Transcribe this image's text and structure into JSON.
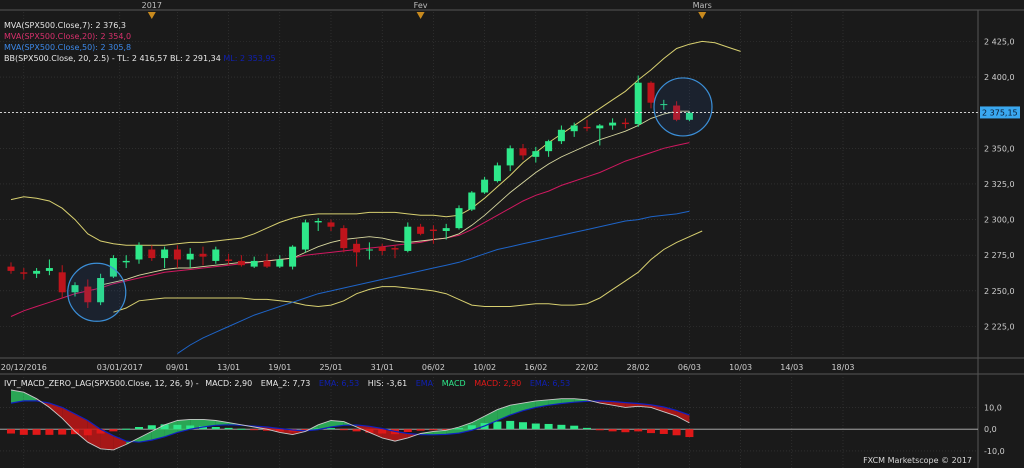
{
  "colors": {
    "background": "#1a1a1a",
    "grid": "#3a3a3a",
    "up_candle": "#2ee88a",
    "down_candle": "#c0141c",
    "mva7": "#d8d8a0",
    "mva20": "#d01860",
    "mva50": "#1e64c8",
    "bollinger": "#d8d070",
    "last_price_badge": "#3aa8f0",
    "highlight_circle": "#3b8fd8",
    "macd_hist_up": "#2ee88a",
    "macd_hist_down": "#e01818",
    "macd_cloud_up": "#2ec060",
    "macd_cloud_down": "#c01818",
    "macd_line": "#c8c8c8",
    "ema_line": "#1020c0"
  },
  "legend": {
    "mva7": "MVA(SPX500.Close,7): 2 376,3",
    "mva20": "MVA(SPX500.Close,20): 2 354,0",
    "mva50": "MVA(SPX500.Close,50): 2 305,8",
    "bb_main": "BB(SPX500.Close, 20, 2.5) -  TL: 2 416,57  BL: 2 291,34",
    "bb_ml": "ML: 2 353,95"
  },
  "macd_header": {
    "name": "IVT_MACD_ZERO_LAG(SPX500.Close, 12, 26, 9) -",
    "macd": "MACD: 2,90",
    "ema2": "EMA_2: 7,73",
    "ema_val": "EMA: 6,53",
    "his": "HIS: -3,61",
    "ema_lbl": "EMA",
    "macd_lbl": "MACD",
    "macd2": "MACD: 2,90",
    "ema2b": "EMA: 6,53"
  },
  "copyright": "FXCM Marketscope © 2017",
  "chart_data": [
    {
      "type": "candlestick",
      "instrument": "SPX500",
      "last_price": 2375.15,
      "last_price_label": "2 375,15",
      "y_range": [
        2205,
        2440
      ],
      "y_ticks": [
        2225,
        2250,
        2275,
        2300,
        2325,
        2350,
        2375,
        2400,
        2425
      ],
      "y_tick_labels": [
        "2 225,0",
        "2 250,0",
        "2 275,0",
        "2 300,0",
        "2 325,0",
        "2 350,0",
        "2 375,0",
        "2 400,0",
        "2 425,0"
      ],
      "top_markers": [
        {
          "label": "2017",
          "index": 11
        },
        {
          "label": "Fev",
          "index": 32
        },
        {
          "label": "Mars",
          "index": 54
        }
      ],
      "x_ticks": [
        {
          "label": "20/12/2016",
          "index": 1
        },
        {
          "label": "03/01/2017",
          "index": 8.5
        },
        {
          "label": "09/01",
          "index": 13
        },
        {
          "label": "13/01",
          "index": 17
        },
        {
          "label": "19/01",
          "index": 21
        },
        {
          "label": "25/01",
          "index": 25
        },
        {
          "label": "31/01",
          "index": 29
        },
        {
          "label": "06/02",
          "index": 33
        },
        {
          "label": "10/02",
          "index": 37
        },
        {
          "label": "16/02",
          "index": 41
        },
        {
          "label": "22/02",
          "index": 45
        },
        {
          "label": "28/02",
          "index": 49
        },
        {
          "label": "06/03",
          "index": 53
        },
        {
          "label": "10/03",
          "index": 57
        },
        {
          "label": "14/03",
          "index": 61
        },
        {
          "label": "18/03",
          "index": 65
        }
      ],
      "candles": [
        {
          "o": 2267,
          "h": 2270,
          "l": 2262,
          "c": 2264
        },
        {
          "o": 2263,
          "h": 2266,
          "l": 2258,
          "c": 2262
        },
        {
          "o": 2262,
          "h": 2266,
          "l": 2259,
          "c": 2264
        },
        {
          "o": 2264,
          "h": 2272,
          "l": 2261,
          "c": 2266
        },
        {
          "o": 2263,
          "h": 2268,
          "l": 2245,
          "c": 2249
        },
        {
          "o": 2249,
          "h": 2256,
          "l": 2246,
          "c": 2254
        },
        {
          "o": 2253,
          "h": 2258,
          "l": 2238,
          "c": 2242
        },
        {
          "o": 2242,
          "h": 2262,
          "l": 2240,
          "c": 2259
        },
        {
          "o": 2260,
          "h": 2275,
          "l": 2259,
          "c": 2273
        },
        {
          "o": 2270,
          "h": 2275,
          "l": 2266,
          "c": 2271
        },
        {
          "o": 2272,
          "h": 2284,
          "l": 2269,
          "c": 2282
        },
        {
          "o": 2279,
          "h": 2282,
          "l": 2271,
          "c": 2273
        },
        {
          "o": 2273,
          "h": 2281,
          "l": 2266,
          "c": 2279
        },
        {
          "o": 2279,
          "h": 2282,
          "l": 2266,
          "c": 2272
        },
        {
          "o": 2272,
          "h": 2280,
          "l": 2266,
          "c": 2276
        },
        {
          "o": 2276,
          "h": 2281,
          "l": 2268,
          "c": 2274
        },
        {
          "o": 2271,
          "h": 2281,
          "l": 2269,
          "c": 2279
        },
        {
          "o": 2272,
          "h": 2276,
          "l": 2268,
          "c": 2271
        },
        {
          "o": 2271,
          "h": 2275,
          "l": 2267,
          "c": 2268
        },
        {
          "o": 2267,
          "h": 2274,
          "l": 2266,
          "c": 2271
        },
        {
          "o": 2271,
          "h": 2276,
          "l": 2266,
          "c": 2267
        },
        {
          "o": 2267,
          "h": 2275,
          "l": 2266,
          "c": 2272
        },
        {
          "o": 2267,
          "h": 2282,
          "l": 2265,
          "c": 2281
        },
        {
          "o": 2279,
          "h": 2300,
          "l": 2277,
          "c": 2298
        },
        {
          "o": 2298,
          "h": 2301,
          "l": 2292,
          "c": 2299
        },
        {
          "o": 2298,
          "h": 2300,
          "l": 2292,
          "c": 2295
        },
        {
          "o": 2294,
          "h": 2296,
          "l": 2277,
          "c": 2280
        },
        {
          "o": 2283,
          "h": 2286,
          "l": 2267,
          "c": 2277
        },
        {
          "o": 2279,
          "h": 2284,
          "l": 2272,
          "c": 2279
        },
        {
          "o": 2281,
          "h": 2283,
          "l": 2275,
          "c": 2278
        },
        {
          "o": 2280,
          "h": 2282,
          "l": 2273,
          "c": 2279
        },
        {
          "o": 2278,
          "h": 2298,
          "l": 2277,
          "c": 2295
        },
        {
          "o": 2295,
          "h": 2297,
          "l": 2289,
          "c": 2290
        },
        {
          "o": 2293,
          "h": 2296,
          "l": 2283,
          "c": 2292
        },
        {
          "o": 2292,
          "h": 2297,
          "l": 2286,
          "c": 2294
        },
        {
          "o": 2294,
          "h": 2310,
          "l": 2293,
          "c": 2308
        },
        {
          "o": 2307,
          "h": 2320,
          "l": 2306,
          "c": 2319
        },
        {
          "o": 2319,
          "h": 2330,
          "l": 2318,
          "c": 2328
        },
        {
          "o": 2327,
          "h": 2340,
          "l": 2326,
          "c": 2338
        },
        {
          "o": 2338,
          "h": 2352,
          "l": 2334,
          "c": 2350
        },
        {
          "o": 2350,
          "h": 2353,
          "l": 2342,
          "c": 2345
        },
        {
          "o": 2344,
          "h": 2351,
          "l": 2340,
          "c": 2348
        },
        {
          "o": 2348,
          "h": 2356,
          "l": 2344,
          "c": 2355
        },
        {
          "o": 2355,
          "h": 2366,
          "l": 2353,
          "c": 2363
        },
        {
          "o": 2362,
          "h": 2368,
          "l": 2358,
          "c": 2366
        },
        {
          "o": 2365,
          "h": 2370,
          "l": 2362,
          "c": 2364
        },
        {
          "o": 2364,
          "h": 2367,
          "l": 2352,
          "c": 2366
        },
        {
          "o": 2366,
          "h": 2371,
          "l": 2363,
          "c": 2368
        },
        {
          "o": 2368,
          "h": 2371,
          "l": 2364,
          "c": 2367
        },
        {
          "o": 2367,
          "h": 2401,
          "l": 2365,
          "c": 2396
        },
        {
          "o": 2396,
          "h": 2397,
          "l": 2378,
          "c": 2382
        },
        {
          "o": 2381,
          "h": 2384,
          "l": 2377,
          "c": 2381
        },
        {
          "o": 2380,
          "h": 2383,
          "l": 2369,
          "c": 2370
        },
        {
          "o": 2370,
          "h": 2376,
          "l": 2369,
          "c": 2375
        }
      ],
      "bollinger_upper": [
        2314,
        2316,
        2315,
        2313,
        2308,
        2300,
        2290,
        2285,
        2283,
        2282,
        2282,
        2282,
        2282,
        2283,
        2284,
        2284,
        2285,
        2286,
        2287,
        2290,
        2294,
        2298,
        2301,
        2303,
        2304,
        2304,
        2304,
        2304,
        2305,
        2305,
        2305,
        2304,
        2303,
        2303,
        2302,
        2303,
        2308,
        2315,
        2323,
        2331,
        2340,
        2347,
        2354,
        2360,
        2366,
        2372,
        2378,
        2384,
        2390,
        2398,
        2405,
        2413,
        2420,
        2423,
        2425,
        2424,
        2421,
        2418
      ],
      "bollinger_lower": [
        null,
        null,
        null,
        null,
        null,
        null,
        null,
        null,
        2235,
        2238,
        2243,
        2244,
        2245,
        2245,
        2245,
        2245,
        2245,
        2245,
        2245,
        2244,
        2244,
        2243,
        2242,
        2240,
        2239,
        2240,
        2243,
        2248,
        2251,
        2253,
        2253,
        2252,
        2251,
        2250,
        2248,
        2244,
        2240,
        2239,
        2239,
        2239,
        2240,
        2241,
        2241,
        2240,
        2240,
        2241,
        2245,
        2251,
        2257,
        2263,
        2272,
        2279,
        2284,
        2288,
        2292
      ],
      "mva7": [
        null,
        null,
        null,
        null,
        null,
        null,
        null,
        2254,
        2256,
        2258,
        2261,
        2263,
        2265,
        2266,
        2266,
        2267,
        2268,
        2269,
        2270,
        2270,
        2271,
        2272,
        2273,
        2277,
        2281,
        2284,
        2286,
        2287,
        2288,
        2287,
        2285,
        2284,
        2285,
        2286,
        2287,
        2290,
        2296,
        2303,
        2311,
        2319,
        2326,
        2333,
        2339,
        2344,
        2348,
        2352,
        2356,
        2359,
        2362,
        2366,
        2371,
        2374,
        2376,
        2376
      ],
      "mva20": [
        2232,
        2236,
        2239,
        2242,
        2245,
        2248,
        2250,
        2252,
        2255,
        2257,
        2259,
        2261,
        2263,
        2264,
        2265,
        2266,
        2267,
        2268,
        2269,
        2270,
        2271,
        2272,
        2273,
        2275,
        2276,
        2277,
        2278,
        2279,
        2280,
        2281,
        2282,
        2283,
        2284,
        2286,
        2287,
        2289,
        2293,
        2298,
        2303,
        2308,
        2313,
        2317,
        2320,
        2324,
        2327,
        2330,
        2333,
        2337,
        2341,
        2344,
        2347,
        2350,
        2352,
        2354
      ],
      "mva50": [
        null,
        null,
        null,
        null,
        null,
        null,
        null,
        null,
        null,
        null,
        null,
        null,
        null,
        2206,
        2212,
        2217,
        2221,
        2225,
        2229,
        2233,
        2236,
        2239,
        2242,
        2245,
        2248,
        2250,
        2252,
        2254,
        2256,
        2258,
        2260,
        2262,
        2264,
        2266,
        2268,
        2270,
        2273,
        2276,
        2279,
        2281,
        2283,
        2285,
        2287,
        2289,
        2291,
        2293,
        2295,
        2297,
        2299,
        2300,
        2302,
        2303,
        2304,
        2305.8
      ],
      "highlight_circles": [
        {
          "index": 6.7,
          "value": 2249
        },
        {
          "index": 52.5,
          "value": 2379
        }
      ]
    },
    {
      "type": "bar",
      "name": "IVT_MACD_ZERO_LAG",
      "y_range": [
        -16,
        18
      ],
      "y_ticks": [
        10,
        0,
        -10
      ],
      "y_tick_labels": [
        "10,0",
        "0,0",
        "-10,0"
      ],
      "histogram": [
        -2.0,
        -2.6,
        -2.6,
        -2.6,
        -2.5,
        -2.3,
        -2.8,
        -2.0,
        -1.0,
        0.2,
        1.0,
        1.8,
        2.2,
        2.0,
        1.7,
        1.4,
        1.0,
        0.6,
        0.2,
        -0.3,
        -0.7,
        -1.0,
        -1.1,
        -0.5,
        0.3,
        0.5,
        -0.2,
        -1.0,
        -1.6,
        -2.0,
        -2.3,
        -1.3,
        -0.7,
        -0.5,
        -0.3,
        0.5,
        1.8,
        2.8,
        3.5,
        3.8,
        3.2,
        2.6,
        2.4,
        2.0,
        1.6,
        0.6,
        -0.5,
        -1.0,
        -1.4,
        -1.0,
        -1.8,
        -2.2,
        -2.8,
        -3.61
      ],
      "macd_line": [
        18,
        17,
        14,
        10,
        5,
        -1,
        -6,
        -9,
        -9.5,
        -7,
        -4,
        -1,
        2,
        4,
        4.5,
        4.5,
        4,
        3,
        2,
        1,
        0,
        -1.5,
        -2.5,
        -1,
        2,
        4,
        3.5,
        1,
        -1.5,
        -4,
        -5.5,
        -4,
        -2,
        -1,
        -0.5,
        1,
        3,
        6,
        9,
        11,
        12,
        13,
        13.5,
        14,
        14,
        13.5,
        12,
        11,
        10,
        10.5,
        10,
        8,
        6,
        2.9
      ],
      "ema_line": [
        12,
        13,
        13,
        12,
        10,
        7,
        4,
        0,
        -3,
        -5.5,
        -6,
        -5,
        -3.5,
        -1.5,
        0,
        1,
        1.8,
        2,
        1.8,
        1.4,
        1,
        0.3,
        -0.4,
        -0.8,
        -0.2,
        1,
        1.8,
        1.9,
        1.3,
        0.3,
        -1,
        -2,
        -2.5,
        -2.6,
        -2.4,
        -1.8,
        -0.5,
        1.5,
        4,
        6.5,
        8.5,
        10,
        11,
        11.8,
        12.4,
        12.8,
        13,
        12.7,
        12.2,
        11.8,
        11.2,
        10.2,
        8.6,
        6.53
      ]
    }
  ]
}
